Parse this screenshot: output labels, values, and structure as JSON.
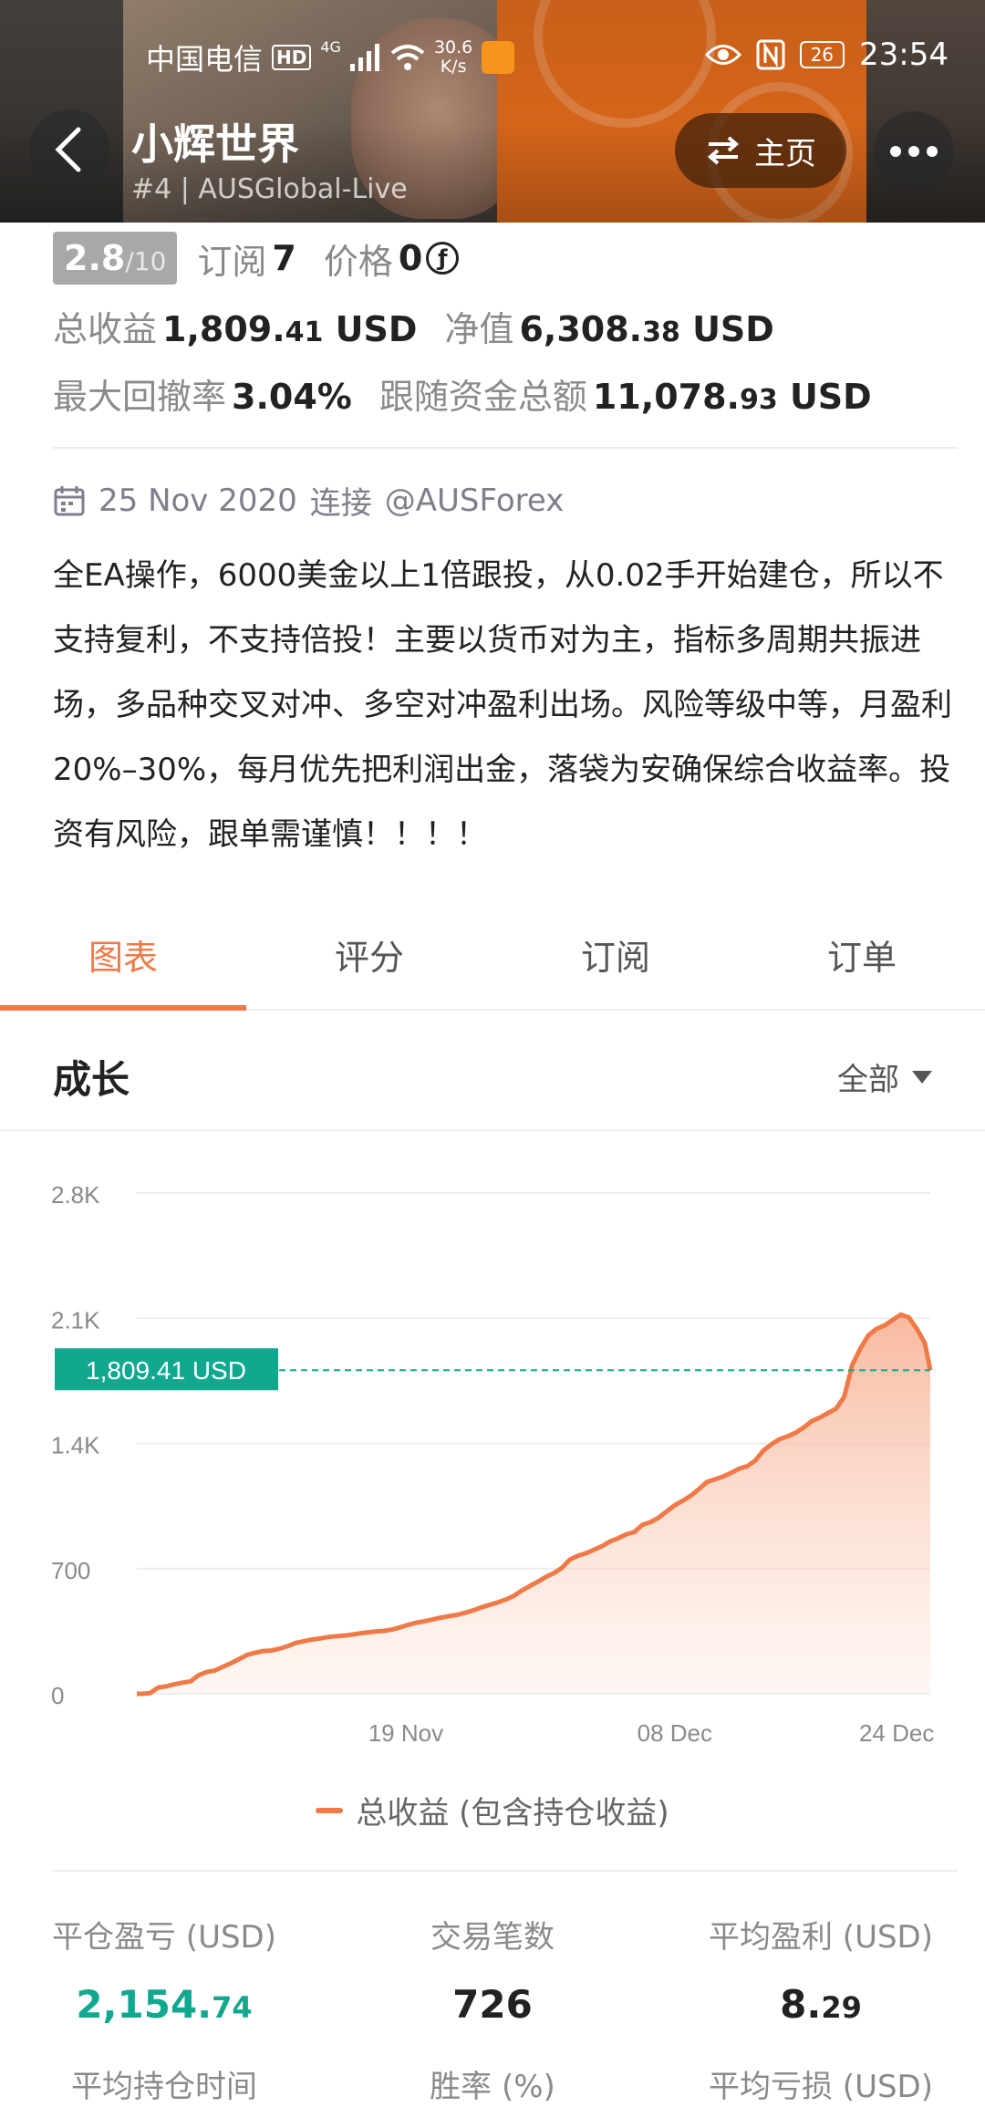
{
  "status_bar": {
    "carrier": "中国电信",
    "hd": "HD",
    "net_type": "4G",
    "speed_value": "30.6",
    "speed_unit": "K/s",
    "battery": "26",
    "time": "23:54"
  },
  "header": {
    "title": "小辉世界",
    "subtitle": "#4 | AUSGlobal-Live",
    "home_label": "主页"
  },
  "rating": {
    "score": "2.8",
    "score_den": "/10",
    "subscribe_label": "订阅",
    "subscribe_count": "7",
    "price_label": "价格",
    "price_value": "0",
    "coin_symbol": "ƒ"
  },
  "stats": {
    "total_profit_label": "总收益",
    "total_profit_main": "1,809.",
    "total_profit_dec": "41",
    "total_profit_unit": "USD",
    "net_value_label": "净值",
    "net_value_main": "6,308.",
    "net_value_dec": "38",
    "net_value_unit": "USD",
    "max_drawdown_label": "最大回撤率",
    "max_drawdown_value": "3.04%",
    "follow_funds_label": "跟随资金总额",
    "follow_funds_main": "11,078.",
    "follow_funds_dec": "93",
    "follow_funds_unit": "USD"
  },
  "meta": {
    "date": "25 Nov 2020",
    "connect_label": "连接",
    "broker": "@AUSForex"
  },
  "description": "全EA操作，6000美金以上1倍跟投，从0.02手开始建仓，所以不支持复利，不支持倍投！主要以货币对为主，指标多周期共振进场，多品种交叉对冲、多空对冲盈利出场。风险等级中等，月盈利20%–30%，每月优先把利润出金，落袋为安确保综合收益率。投资有风险，跟单需谨慎！！！！",
  "tabs": [
    "图表",
    "评分",
    "订阅",
    "订单"
  ],
  "section": {
    "title": "成长",
    "range": "全部"
  },
  "colors": {
    "accent": "#ef7a47",
    "highlight_green": "#11a88f"
  },
  "chart_data": {
    "type": "area",
    "series": [
      {
        "name": "总收益 (包含持仓收益)"
      }
    ],
    "x": [
      0,
      4,
      10,
      16,
      22,
      28,
      34,
      40,
      46,
      52,
      58,
      64,
      70,
      76,
      82,
      88,
      94,
      100,
      106,
      112,
      118,
      124,
      130,
      136,
      142,
      148,
      154,
      160,
      166,
      172,
      178,
      184,
      190,
      196,
      202,
      208,
      214,
      220,
      226,
      232,
      238,
      244,
      250,
      256,
      262,
      268,
      274,
      280,
      286,
      292,
      298,
      304,
      310,
      316,
      322,
      328,
      334,
      340,
      346,
      352,
      358,
      364,
      370,
      376,
      382,
      388,
      394,
      400,
      406,
      412,
      418,
      424,
      430,
      436,
      442,
      448,
      454,
      460,
      466,
      472,
      478,
      484,
      490,
      496,
      502,
      508,
      514,
      520,
      526,
      532,
      538,
      544,
      550,
      556,
      562,
      568,
      574,
      580,
      586,
      590
    ],
    "values": [
      0,
      0,
      4,
      35,
      42,
      53,
      62,
      70,
      104,
      122,
      130,
      151,
      171,
      194,
      218,
      230,
      239,
      242,
      252,
      266,
      284,
      294,
      303,
      309,
      317,
      322,
      325,
      331,
      338,
      344,
      349,
      352,
      360,
      372,
      386,
      398,
      406,
      416,
      426,
      434,
      441,
      453,
      466,
      483,
      496,
      510,
      526,
      546,
      576,
      602,
      626,
      653,
      674,
      704,
      750,
      772,
      786,
      806,
      826,
      852,
      870,
      892,
      905,
      945,
      960,
      985,
      1020,
      1054,
      1080,
      1108,
      1145,
      1185,
      1200,
      1215,
      1236,
      1259,
      1273,
      1305,
      1361,
      1396,
      1424,
      1440,
      1460,
      1490,
      1525,
      1545,
      1570,
      1595,
      1660,
      1840,
      1930,
      2005,
      2040,
      2060,
      2090,
      2120,
      2105,
      2040,
      1960,
      1809.41
    ],
    "x_ticks": [
      {
        "x": 200,
        "label": "19 Nov"
      },
      {
        "x": 400,
        "label": "08 Dec"
      },
      {
        "x": 565,
        "label": "24 Dec"
      }
    ],
    "xlim": [
      0,
      590
    ],
    "y_ticks": [
      0,
      700,
      1400,
      2100,
      2800
    ],
    "y_tick_labels": [
      "0",
      "700",
      "1.4K",
      "2.1K",
      "2.8K"
    ],
    "ylim": [
      0,
      2800
    ],
    "current_label": "1,809.41 USD",
    "current_value": 1809.41,
    "legend": "总收益 (包含持仓收益)",
    "grid": true
  },
  "kpis": [
    {
      "label": "平仓盈亏 (USD)",
      "value_main": "2,154.",
      "value_dec": "74"
    },
    {
      "label": "交易笔数",
      "value_main": "726",
      "value_dec": ""
    },
    {
      "label": "平均盈利 (USD)",
      "value_main": "8.",
      "value_dec": "29"
    },
    {
      "label": "平均持仓时间"
    },
    {
      "label": "胜率 (%)"
    },
    {
      "label": "平均亏损 (USD)"
    }
  ]
}
